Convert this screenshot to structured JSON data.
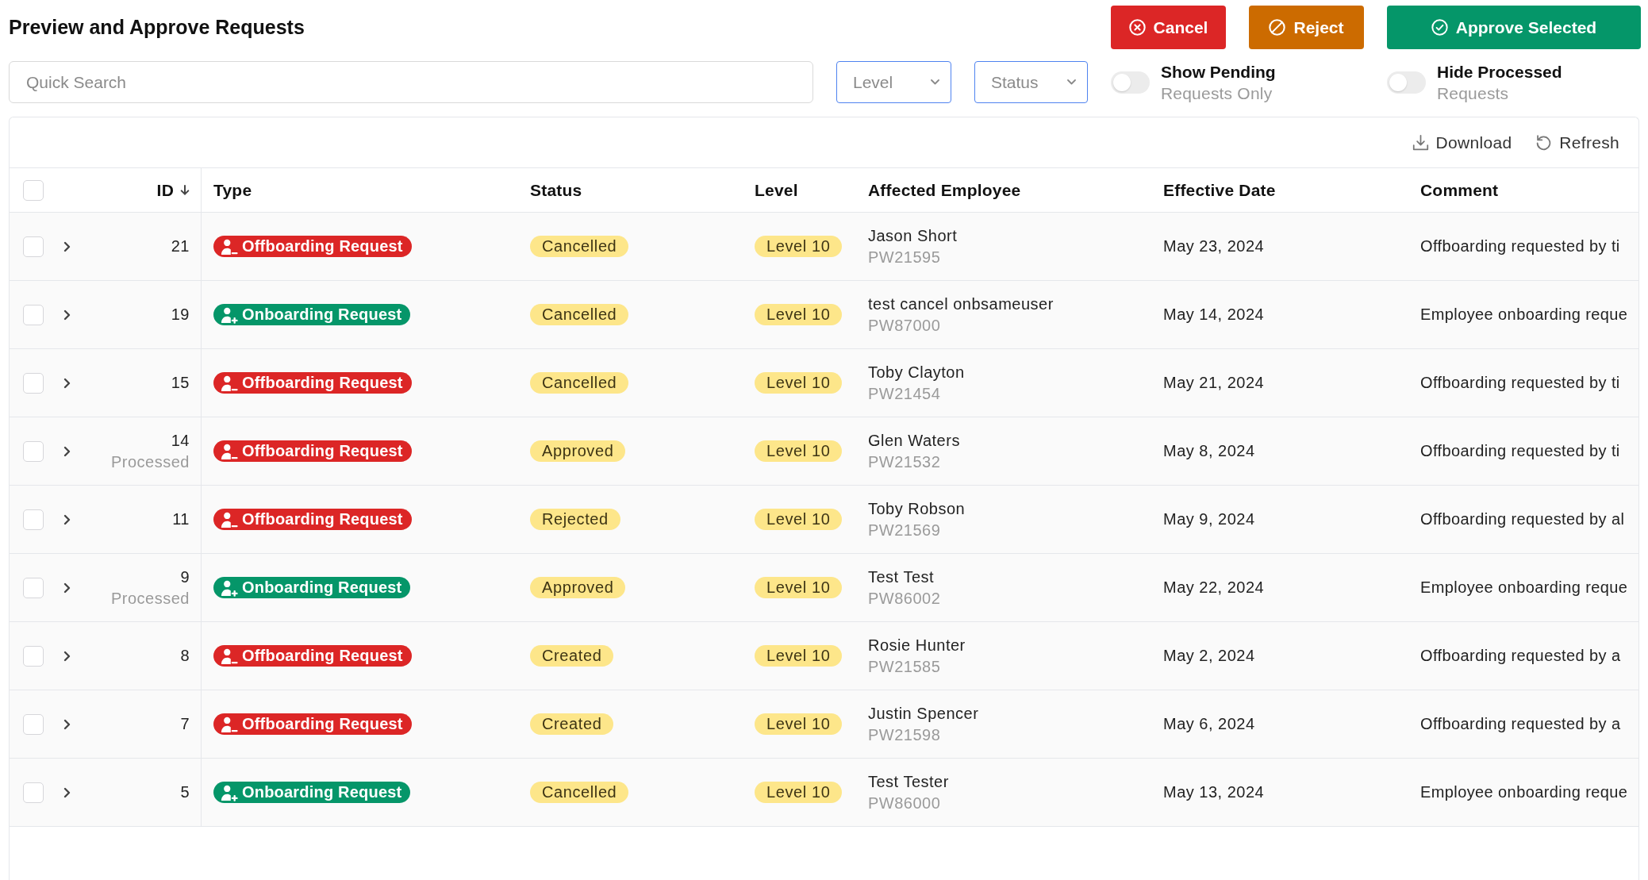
{
  "title": "Preview and Approve Requests",
  "actions": [
    {
      "label": "Cancel",
      "kind": "cancel"
    },
    {
      "label": "Reject",
      "kind": "reject"
    },
    {
      "label": "Approve Selected",
      "kind": "approve"
    }
  ],
  "search": {
    "placeholder": "Quick Search"
  },
  "filters": [
    {
      "placeholder": "Level"
    },
    {
      "placeholder": "Status"
    }
  ],
  "toggles": [
    {
      "label": "Show Pending",
      "sublabel": "Requests Only",
      "on": false
    },
    {
      "label": "Hide Processed",
      "sublabel": "Requests",
      "on": false
    }
  ],
  "toolbar": [
    {
      "label": "Download",
      "kind": "download"
    },
    {
      "label": "Refresh",
      "kind": "refresh"
    }
  ],
  "table": {
    "select_all": {
      "checked": false
    },
    "columns": [
      {
        "label": "ID",
        "sorted": true,
        "descending": true
      },
      {
        "label": "Type"
      },
      {
        "label": "Status"
      },
      {
        "label": "Level"
      },
      {
        "label": "Affected Employee"
      },
      {
        "label": "Effective Date"
      },
      {
        "label": "Comment"
      }
    ],
    "rows": [
      {
        "checked": false,
        "expanded": false,
        "id": "21",
        "type": {
          "label": "Offboarding Request",
          "kind": "offboarding"
        },
        "status": "Cancelled",
        "level": "Level 10",
        "employee": "Jason Short",
        "employee_id": "PW21595",
        "date": "May 23, 2024",
        "comment": "Offboarding requested by ti"
      },
      {
        "checked": false,
        "expanded": false,
        "id": "19",
        "type": {
          "label": "Onboarding Request",
          "kind": "onboarding"
        },
        "status": "Cancelled",
        "level": "Level 10",
        "employee": "test cancel onbsameuser",
        "employee_id": "PW87000",
        "date": "May 14, 2024",
        "comment": "Employee onboarding reque"
      },
      {
        "checked": false,
        "expanded": false,
        "id": "15",
        "type": {
          "label": "Offboarding Request",
          "kind": "offboarding"
        },
        "status": "Cancelled",
        "level": "Level 10",
        "employee": "Toby Clayton",
        "employee_id": "PW21454",
        "date": "May 21, 2024",
        "comment": "Offboarding requested by ti"
      },
      {
        "checked": false,
        "expanded": false,
        "id": "14",
        "note": "Processed",
        "type": {
          "label": "Offboarding Request",
          "kind": "offboarding"
        },
        "status": "Approved",
        "level": "Level 10",
        "employee": "Glen Waters",
        "employee_id": "PW21532",
        "date": "May 8, 2024",
        "comment": "Offboarding requested by ti"
      },
      {
        "checked": false,
        "expanded": false,
        "id": "11",
        "type": {
          "label": "Offboarding Request",
          "kind": "offboarding"
        },
        "status": "Rejected",
        "level": "Level 10",
        "employee": "Toby Robson",
        "employee_id": "PW21569",
        "date": "May 9, 2024",
        "comment": "Offboarding requested by al"
      },
      {
        "checked": false,
        "expanded": false,
        "id": "9",
        "note": "Processed",
        "type": {
          "label": "Onboarding Request",
          "kind": "onboarding"
        },
        "status": "Approved",
        "level": "Level 10",
        "employee": "Test Test",
        "employee_id": "PW86002",
        "date": "May 22, 2024",
        "comment": "Employee onboarding reque"
      },
      {
        "checked": false,
        "expanded": false,
        "id": "8",
        "type": {
          "label": "Offboarding Request",
          "kind": "offboarding"
        },
        "status": "Created",
        "level": "Level 10",
        "employee": "Rosie Hunter",
        "employee_id": "PW21585",
        "date": "May 2, 2024",
        "comment": "Offboarding requested by a"
      },
      {
        "checked": false,
        "expanded": false,
        "id": "7",
        "type": {
          "label": "Offboarding Request",
          "kind": "offboarding"
        },
        "status": "Created",
        "level": "Level 10",
        "employee": "Justin Spencer",
        "employee_id": "PW21598",
        "date": "May 6, 2024",
        "comment": "Offboarding requested by a"
      },
      {
        "checked": false,
        "expanded": false,
        "id": "5",
        "type": {
          "label": "Onboarding Request",
          "kind": "onboarding"
        },
        "status": "Cancelled",
        "level": "Level 10",
        "employee": "Test Tester",
        "employee_id": "PW86000",
        "date": "May 13, 2024",
        "comment": "Employee onboarding reque"
      }
    ]
  }
}
